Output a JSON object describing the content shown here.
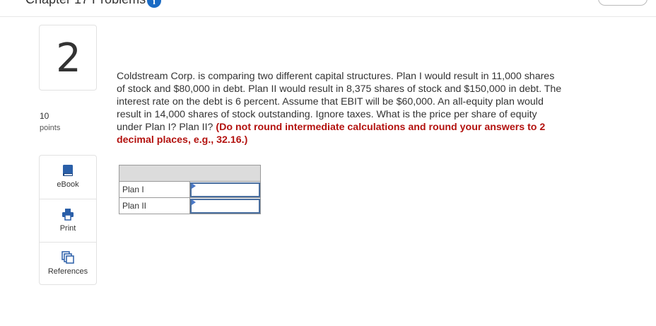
{
  "header": {
    "chapter_title": "Chapter 17 Problems",
    "info_icon": "info-icon"
  },
  "question": {
    "number": "2",
    "points_value": "10",
    "points_label": "points",
    "text": "Coldstream Corp. is comparing two different capital structures. Plan I would result in 11,000 shares of stock and $80,000 in debt. Plan II would result in 8,375 shares of stock and $150,000 in debt. The interest rate on the debt is 6 percent. Assume that EBIT will be $60,000. An all-equity plan would result in 14,000 shares of stock outstanding. Ignore taxes. What is the price per share of equity under Plan I? Plan II?",
    "instruction": "(Do not round intermediate calculations and round your answers to 2 decimal places, e.g., 32.16.)"
  },
  "tools": [
    {
      "label": "eBook",
      "icon": "book-icon"
    },
    {
      "label": "Print",
      "icon": "printer-icon"
    },
    {
      "label": "References",
      "icon": "references-icon"
    }
  ],
  "answer_table": {
    "header": "",
    "rows": [
      {
        "label": "Plan I",
        "value": ""
      },
      {
        "label": "Plan II",
        "value": ""
      }
    ]
  },
  "colors": {
    "accent": "#1a6bc4",
    "instruction_red": "#b3120f",
    "input_border": "#4a6fa0"
  }
}
